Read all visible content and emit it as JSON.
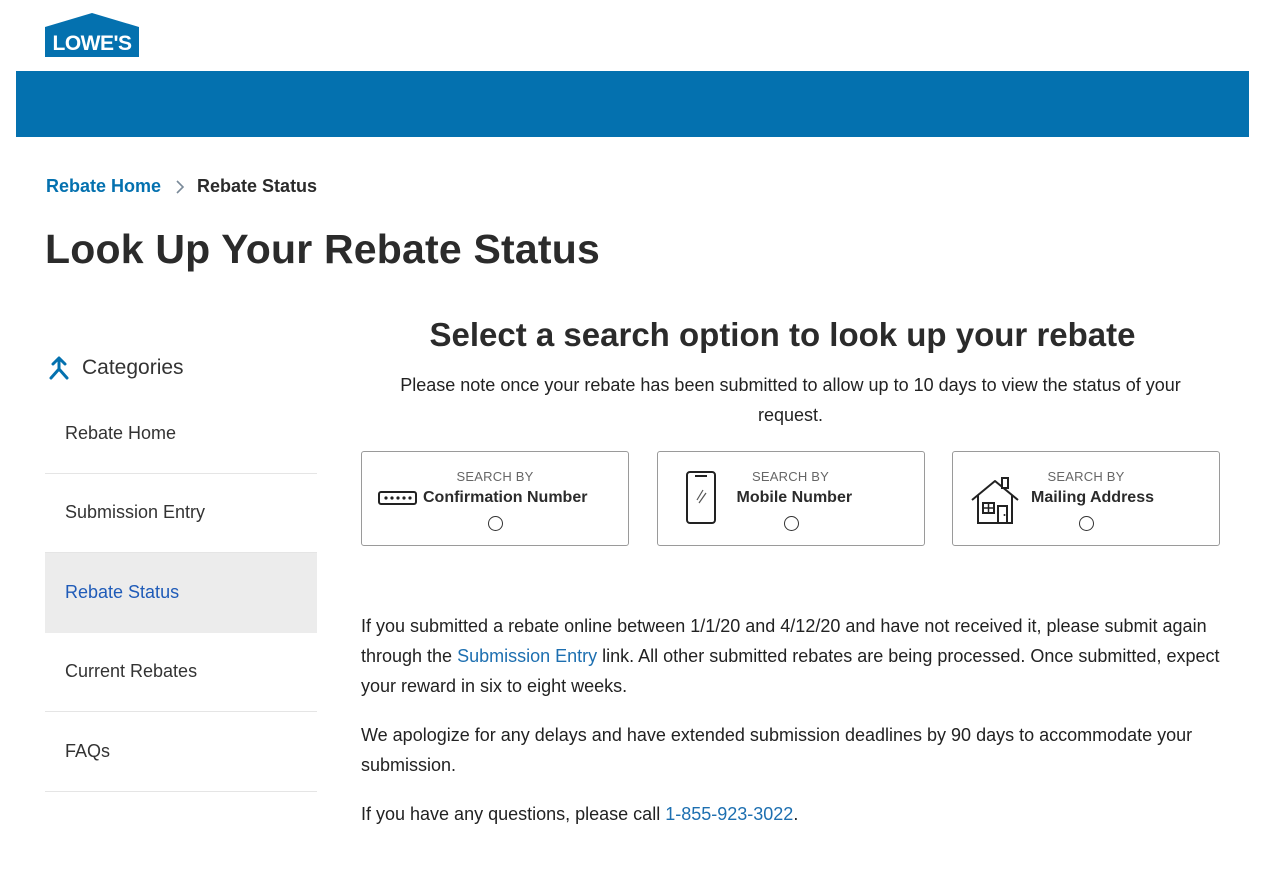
{
  "brand": {
    "logo_text": "LOWE'S",
    "color_primary": "#0471af",
    "color_link": "#1d6fb0",
    "color_active": "#1f5bb8"
  },
  "breadcrumb": {
    "home": "Rebate Home",
    "current": "Rebate Status"
  },
  "page_title": "Look Up Your Rebate Status",
  "sidebar": {
    "heading": "Categories",
    "items": [
      {
        "label": "Rebate Home",
        "active": false
      },
      {
        "label": "Submission Entry",
        "active": false
      },
      {
        "label": "Rebate Status",
        "active": true
      },
      {
        "label": "Current Rebates",
        "active": false
      },
      {
        "label": "FAQs",
        "active": false
      }
    ]
  },
  "search": {
    "title": "Select a search option to look up your rebate",
    "note": "Please note once your rebate has been submitted to allow up to 10 days to view the status of your request.",
    "options": [
      {
        "by": "SEARCH BY",
        "label": "Confirmation Number",
        "icon": "confirmation-number-icon"
      },
      {
        "by": "SEARCH BY",
        "label": "Mobile Number",
        "icon": "mobile-phone-icon"
      },
      {
        "by": "SEARCH BY",
        "label": "Mailing Address",
        "icon": "house-icon"
      }
    ]
  },
  "info": {
    "p1_before": "If you submitted a rebate online between 1/1/20 and 4/12/20 and have not received it, please submit again through the ",
    "p1_link": "Submission Entry",
    "p1_after": " link. All other submitted rebates are being processed. Once submitted, expect your reward in six to eight weeks.",
    "p2": "We apologize for any delays and have extended submission deadlines by 90 days to accommodate your submission.",
    "p3_before": "If you have any questions, please call ",
    "p3_phone": "1-855-923-3022",
    "p3_after": "."
  }
}
